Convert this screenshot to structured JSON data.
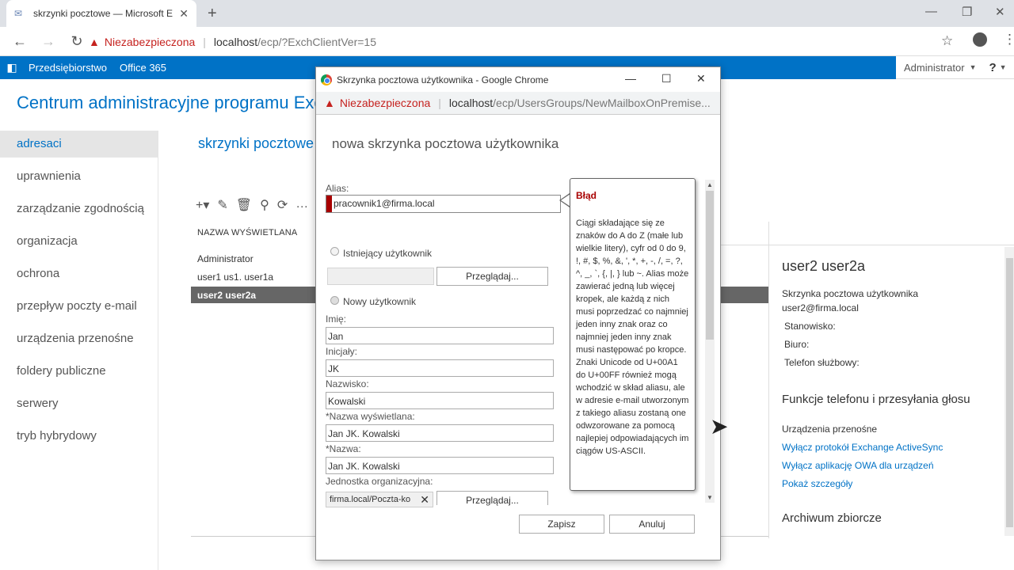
{
  "browser": {
    "tab_title": "skrzynki pocztowe — Microsoft E",
    "url_warning": "Niezabezpieczona",
    "url_host": "localhost",
    "url_path": "/ecp/?ExchClientVer=15"
  },
  "appbar": {
    "items": [
      "Przedsiębiorstwo",
      "Office 365"
    ],
    "user": "Administrator",
    "help": "?"
  },
  "page": {
    "title": "Centrum administracyjne programu Exchange",
    "subtitle": "skrzynki pocztowe"
  },
  "leftnav": [
    "adresaci",
    "uprawnienia",
    "zarządzanie zgodnością",
    "organizacja",
    "ochrona",
    "przepływ poczty e-mail",
    "urządzenia przenośne",
    "foldery publiczne",
    "serwery",
    "tryb hybrydowy"
  ],
  "list": {
    "column": "NAZWA WYŚWIETLANA",
    "rows": [
      "Administrator",
      "user1 us1. user1a",
      "user2 user2a"
    ]
  },
  "details": {
    "name": "user2 user2a",
    "type": "Skrzynka pocztowa użytkownika",
    "email": "user2@firma.local",
    "fields": [
      "Stanowisko:",
      "Biuro:",
      "Telefon służbowy:"
    ],
    "section_phone": "Funkcje telefonu i przesyłania głosu",
    "mobile_label": "Urządzenia przenośne",
    "links": [
      "Wyłącz protokół Exchange ActiveSync",
      "Wyłącz aplikację OWA dla urządzeń",
      "Pokaż szczegóły"
    ],
    "section_archive": "Archiwum zbiorcze"
  },
  "popup": {
    "window_title": "Skrzynka pocztowa użytkownika - Google Chrome",
    "url_warning": "Niezabezpieczona",
    "url_host": "localhost",
    "url_path": "/ecp/UsersGroups/NewMailboxOnPremise...",
    "heading": "nowa skrzynka pocztowa użytkownika",
    "alias_label": "Alias:",
    "alias_value": "pracownik1@firma.local",
    "radio_existing": "Istniejący użytkownik",
    "browse_label": "Przeglądaj...",
    "radio_new": "Nowy użytkownik",
    "first_name_label": "Imię:",
    "first_name": "Jan",
    "initials_label": "Inicjały:",
    "initials": "JK",
    "last_name_label": "Nazwisko:",
    "last_name": "Kowalski",
    "display_name_label": "*Nazwa wyświetlana:",
    "display_name": "Jan JK. Kowalski",
    "name_label": "*Nazwa:",
    "name": "Jan JK. Kowalski",
    "ou_label": "Jednostka organizacyjna:",
    "ou_value": "firma.local/Poczta-ko",
    "save": "Zapisz",
    "cancel": "Anuluj"
  },
  "error": {
    "title": "Błąd",
    "text": "Ciągi składające się ze znaków do A do Z (małe lub wielkie litery), cyfr od 0 do 9, !, #, $, %, &, ', *, +, -, /, =, ?, ^, _, `, {, |, } lub ~. Alias może zawierać jedną lub więcej kropek, ale każdą z nich musi poprzedzać co najmniej jeden inny znak oraz co najmniej jeden inny znak musi następować po kropce. Znaki Unicode od U+00A1 do U+00FF również mogą wchodzić w skład aliasu, ale w adresie e-mail utworzonym z takiego aliasu zostaną one odwzorowane za pomocą najlepiej odpowiadających im ciągów US-ASCII."
  }
}
